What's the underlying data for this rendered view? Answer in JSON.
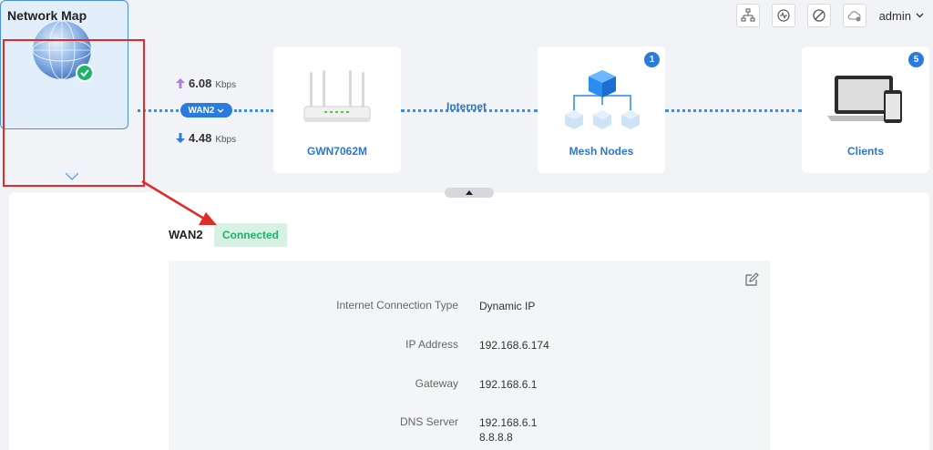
{
  "header": {
    "title": "Network Map",
    "user": "admin"
  },
  "nodes": {
    "internet": {
      "label": "Internet"
    },
    "router": {
      "label": "GWN7062M"
    },
    "mesh": {
      "label": "Mesh Nodes",
      "count": "1"
    },
    "clients": {
      "label": "Clients",
      "count": "5"
    }
  },
  "link": {
    "wan_label": "WAN2",
    "upload": {
      "value": "6.08",
      "unit": "Kbps"
    },
    "download": {
      "value": "4.48",
      "unit": "Kbps"
    }
  },
  "detail": {
    "wan_name": "WAN2",
    "status": "Connected",
    "rows": [
      {
        "label": "Internet Connection Type",
        "value": "Dynamic IP"
      },
      {
        "label": "IP Address",
        "value": "192.168.6.174"
      },
      {
        "label": "Gateway",
        "value": "192.168.6.1"
      },
      {
        "label": "DNS Server",
        "value": "192.168.6.1",
        "value2": "8.8.8.8"
      }
    ]
  },
  "colors": {
    "accent": "#2a7be0",
    "success": "#1bb468",
    "highlight": "#e02b2b"
  }
}
